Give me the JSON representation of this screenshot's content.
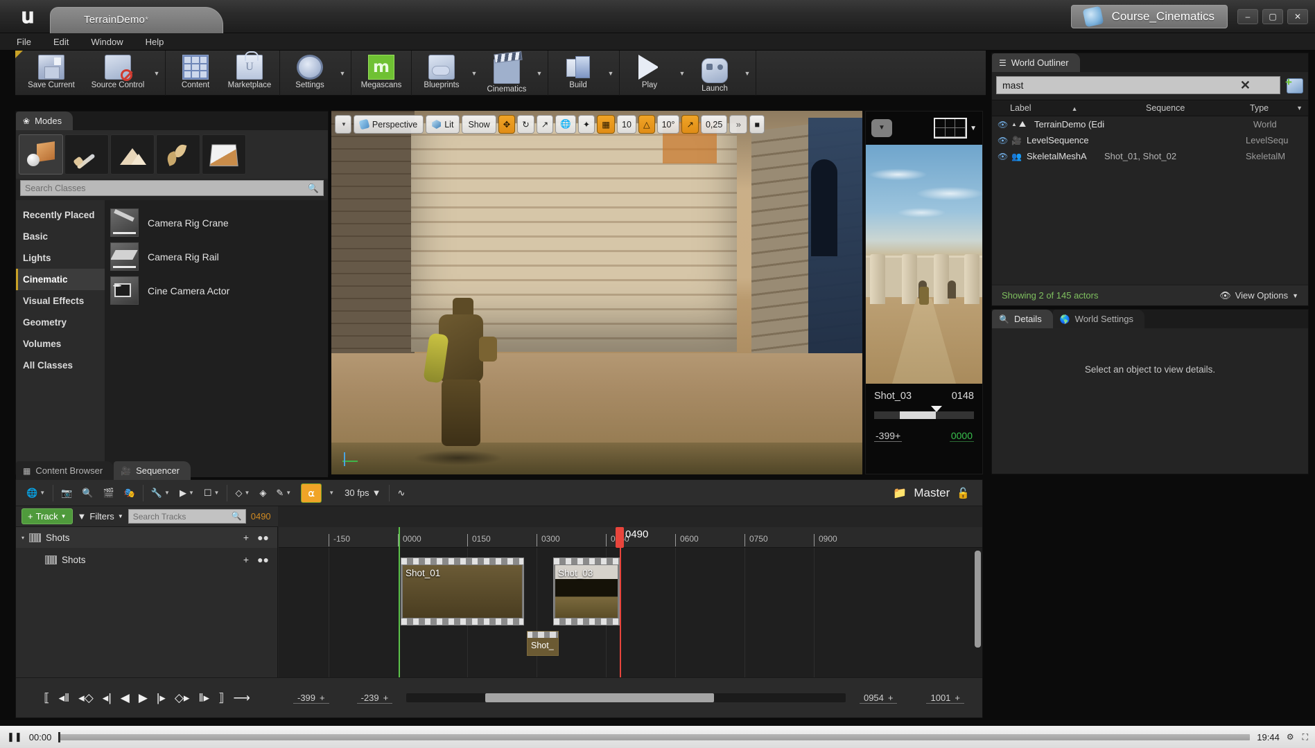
{
  "window": {
    "logo": "unreal-logo",
    "project_tab": "TerrainDemo",
    "project_modified_mark": "*",
    "right_tab": "Course_Cinematics",
    "minimize": "–",
    "maximize": "▢",
    "close": "✕"
  },
  "menubar": {
    "items": [
      "File",
      "Edit",
      "Window",
      "Help"
    ]
  },
  "toolbar": {
    "groups": [
      {
        "items": [
          {
            "label": "Save Current",
            "icon": "save-icon",
            "caret": false
          },
          {
            "label": "Source Control",
            "icon": "source-control-icon",
            "caret": true
          }
        ]
      },
      {
        "items": [
          {
            "label": "Content",
            "icon": "content-icon",
            "caret": false
          },
          {
            "label": "Marketplace",
            "icon": "marketplace-icon",
            "caret": false
          }
        ]
      },
      {
        "items": [
          {
            "label": "Settings",
            "icon": "gear-icon",
            "caret": true
          }
        ]
      },
      {
        "items": [
          {
            "label": "Megascans",
            "icon": "megascans-icon",
            "caret": false
          }
        ]
      },
      {
        "items": [
          {
            "label": "Blueprints",
            "icon": "blueprints-icon",
            "caret": true
          },
          {
            "label": "Cinematics",
            "icon": "cinematics-icon",
            "caret": true
          }
        ]
      },
      {
        "items": [
          {
            "label": "Build",
            "icon": "build-icon",
            "caret": true
          }
        ]
      },
      {
        "items": [
          {
            "label": "Play",
            "icon": "play-icon",
            "caret": true
          },
          {
            "label": "Launch",
            "icon": "launch-icon",
            "caret": true
          }
        ]
      }
    ]
  },
  "modes": {
    "tab_label": "Modes",
    "tab_icon": "modes-icon",
    "mode_buttons": [
      {
        "name": "place-mode",
        "selected": true
      },
      {
        "name": "paint-mode",
        "selected": false
      },
      {
        "name": "landscape-mode",
        "selected": false
      },
      {
        "name": "foliage-mode",
        "selected": false
      },
      {
        "name": "geometry-editing-mode",
        "selected": false
      }
    ],
    "search_placeholder": "Search Classes",
    "categories": [
      {
        "label": "Recently Placed",
        "selected": false
      },
      {
        "label": "Basic",
        "selected": false
      },
      {
        "label": "Lights",
        "selected": false
      },
      {
        "label": "Cinematic",
        "selected": true
      },
      {
        "label": "Visual Effects",
        "selected": false
      },
      {
        "label": "Geometry",
        "selected": false
      },
      {
        "label": "Volumes",
        "selected": false
      },
      {
        "label": "All Classes",
        "selected": false
      }
    ],
    "assets": [
      {
        "label": "Camera Rig Crane",
        "thumb": "camera-rig-crane-thumb"
      },
      {
        "label": "Camera Rig Rail",
        "thumb": "camera-rig-rail-thumb"
      },
      {
        "label": "Cine Camera Actor",
        "thumb": "cine-camera-actor-thumb"
      }
    ]
  },
  "viewport": {
    "menu_caret": "▼",
    "view_mode": "Perspective",
    "lighting_mode": "Lit",
    "show_menu": "Show",
    "transform_tools": [
      "translate-gizmo-icon",
      "rotate-gizmo-icon",
      "scale-gizmo-icon"
    ],
    "coord_system": "world-coords-icon",
    "surface_snap": "surface-snap-icon",
    "grid_snap_enabled": true,
    "grid_snap_value": "10",
    "rotation_snap_value": "10°",
    "scale_snap_value": "0,25",
    "expand_caret": "»",
    "camera_speed_icon": "camera-speed-icon"
  },
  "preview": {
    "dropdown": "▼",
    "grid_icon": "composition-grid-icon",
    "grid_caret": "▼",
    "shot_name": "Shot_03",
    "frame": "0148",
    "range_start": "-399",
    "range_start_suffix": "+",
    "current_value": "0000"
  },
  "outliner": {
    "tab_label": "World Outliner",
    "tab_icon": "outliner-icon",
    "search_value": "mast",
    "clear_icon": "✕",
    "add_icon": "add-actor-icon",
    "columns": [
      "Label",
      "Sequence",
      "Type"
    ],
    "sort_indicator": "▲",
    "type_caret": "▼",
    "rows": [
      {
        "label": "TerrainDemo (Edi",
        "sequence": "",
        "type": "World",
        "icon": "world-icon",
        "expander": "▲",
        "indent": 0
      },
      {
        "label": "LevelSequence",
        "sequence": "",
        "type": "LevelSequ",
        "icon": "level-sequence-icon",
        "expander": "",
        "indent": 1
      },
      {
        "label": "SkeletalMeshA",
        "sequence": "Shot_01, Shot_02",
        "type": "SkeletalM",
        "icon": "skeletal-mesh-icon",
        "expander": "",
        "indent": 1
      }
    ],
    "status": "Showing 2 of 145 actors",
    "view_options": "View Options",
    "view_options_caret": "▼",
    "eye_icon": "eye-icon"
  },
  "details": {
    "tabs": [
      {
        "label": "Details",
        "icon": "details-icon",
        "active": true
      },
      {
        "label": "World Settings",
        "icon": "world-settings-icon",
        "active": false
      }
    ],
    "empty_message": "Select an object to view details."
  },
  "sequencer": {
    "tabs": [
      {
        "label": "Content Browser",
        "icon": "content-browser-icon",
        "active": false
      },
      {
        "label": "Sequencer",
        "icon": "sequencer-icon",
        "active": true
      }
    ],
    "toolbar_icons": [
      {
        "name": "general-options-icon",
        "caret": true
      },
      {
        "name": "create-camera-icon",
        "caret": false
      },
      {
        "name": "find-icon",
        "caret": false
      },
      {
        "name": "camera-cut-icon",
        "caret": false
      },
      {
        "name": "render-movie-icon",
        "caret": false
      },
      {
        "name": "actions-wrench-icon",
        "caret": true
      },
      {
        "name": "playback-options-icon",
        "caret": true
      },
      {
        "name": "select-edit-icon",
        "caret": true
      },
      {
        "name": "key-interpolation-icon",
        "caret": true
      },
      {
        "name": "auto-key-icon",
        "caret": false
      },
      {
        "name": "paint-key-icon",
        "caret": true
      }
    ],
    "snap_enabled": true,
    "snap_icon": "magnet-icon",
    "snap_caret": "▼",
    "fps": "30 fps",
    "fps_caret": "▼",
    "curve_editor_icon": "curve-editor-icon",
    "breadcrumb_folder_icon": "folder-icon",
    "breadcrumb": "Master",
    "lock_icon": "unlocked-icon",
    "add_track_label": "Track",
    "add_track_plus": "+",
    "add_track_caret": "▼",
    "filters_label": "Filters",
    "filters_icon": "filter-icon",
    "filters_caret": "▼",
    "search_placeholder": "Search Tracks",
    "current_frame": "0490",
    "tracks": [
      {
        "label": "Shots",
        "icon": "shots-track-icon",
        "expander": "▾",
        "level": 0
      },
      {
        "label": "Shots",
        "icon": "shots-track-icon",
        "expander": "",
        "level": 1
      }
    ],
    "track_action_icons": [
      "add-icon",
      "filter-track-icon"
    ],
    "ruler_ticks": [
      {
        "label": "-150",
        "pos": -150
      },
      {
        "label": "0000",
        "pos": 0
      },
      {
        "label": "0150",
        "pos": 150
      },
      {
        "label": "0300",
        "pos": 300
      },
      {
        "label": "0450",
        "pos": 450
      },
      {
        "label": "0600",
        "pos": 600
      },
      {
        "label": "0750",
        "pos": 750
      },
      {
        "label": "0900",
        "pos": 900
      }
    ],
    "playhead_frame": "0490",
    "clips": [
      {
        "name": "Shot_01",
        "start": 0,
        "end": 225,
        "lane": 0
      },
      {
        "name": "Shot_03",
        "start": 290,
        "end": 400,
        "lane": 0
      },
      {
        "name": "Shot_",
        "start": 237,
        "end": 285,
        "lane": 1
      }
    ],
    "transport_buttons": [
      "jump-to-start-icon",
      "step-back-frames-icon",
      "previous-key-icon",
      "step-back-icon",
      "play-reverse-icon",
      "play-forward-icon",
      "step-forward-icon",
      "next-key-icon",
      "step-forward-frames-icon",
      "jump-to-end-icon",
      "loop-icon"
    ],
    "range_left": [
      "-399",
      "-239"
    ],
    "range_right": [
      "0954",
      "1001"
    ],
    "range_suffix": "+"
  },
  "statusbar": {
    "play_icon": "pause-icon",
    "time": "00:00",
    "duration": "19:44",
    "fullscreen_icon": "fullscreen-icon",
    "settings_icon": "settings-icon"
  },
  "colors": {
    "accent_orange": "#f0a427",
    "accent_green": "#5cc24a",
    "accent_red": "#e8453c",
    "panel_bg": "#242424",
    "toolbar_bg": "#2f2f2f"
  }
}
